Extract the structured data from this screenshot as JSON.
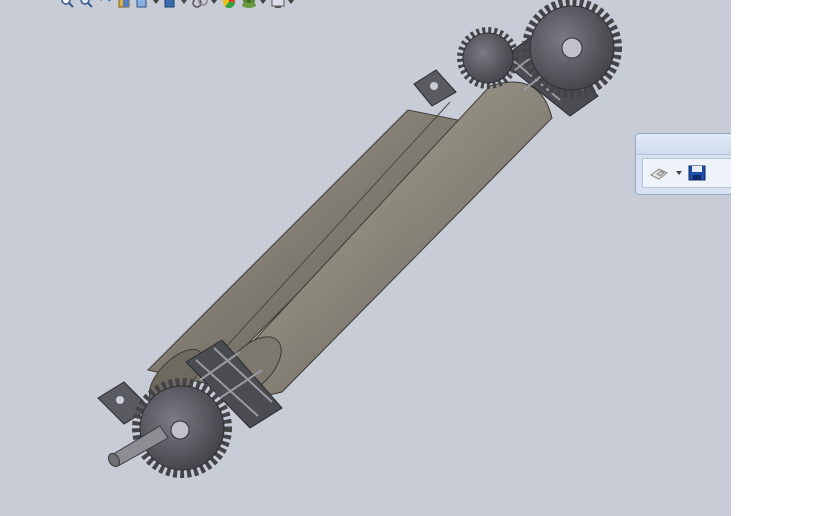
{
  "window": {
    "title": ""
  },
  "heads_up_toolbar": {
    "items": [
      {
        "icon": "zoom-to-fit-icon",
        "has_dropdown": false
      },
      {
        "icon": "zoom-to-area-icon",
        "has_dropdown": false
      },
      {
        "icon": "previous-view-icon",
        "has_dropdown": false
      },
      {
        "icon": "section-view-icon",
        "has_dropdown": false
      },
      {
        "icon": "view-orientation-icon",
        "has_dropdown": true
      },
      {
        "icon": "display-style-icon",
        "has_dropdown": true
      },
      {
        "icon": "hide-show-items-icon",
        "has_dropdown": true
      },
      {
        "icon": "edit-appearance-icon",
        "has_dropdown": false
      },
      {
        "icon": "apply-scene-icon",
        "has_dropdown": true
      },
      {
        "icon": "view-settings-icon",
        "has_dropdown": true
      }
    ]
  },
  "popup_toolbar": {
    "items": [
      {
        "icon": "rebuild-options-icon",
        "has_dropdown": true
      },
      {
        "icon": "save-icon",
        "has_dropdown": false
      }
    ]
  },
  "model": {
    "description": "",
    "colors": {
      "roller": "#8a8578",
      "gear": "#55565c",
      "background": "#c8ccd6"
    }
  }
}
